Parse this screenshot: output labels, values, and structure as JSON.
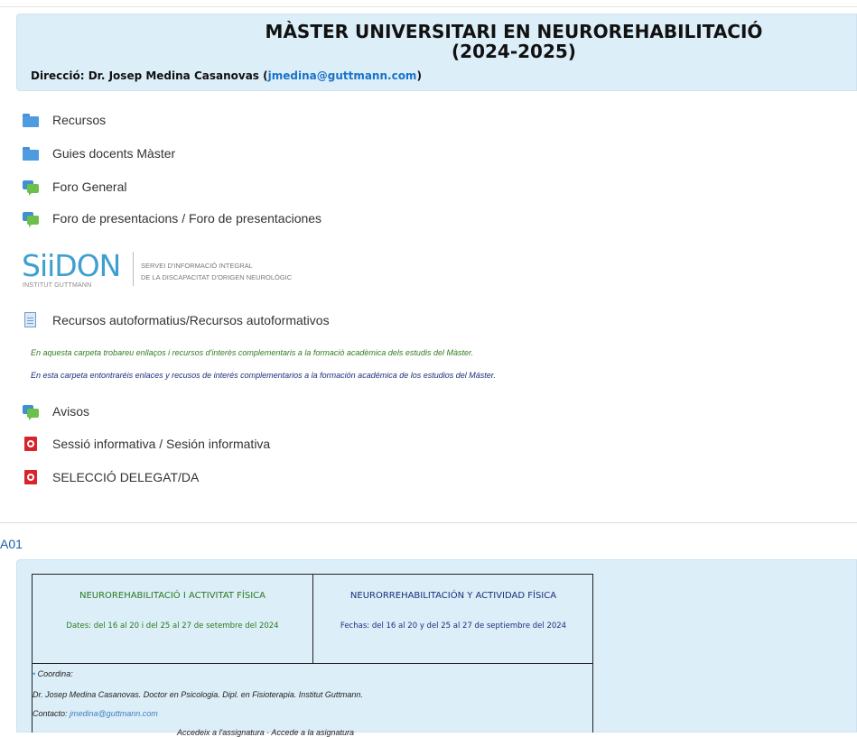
{
  "header": {
    "title_line1": "MÀSTER UNIVERSITARI EN NEUROREHABILITACIÓ",
    "title_line2": "(2024-2025)",
    "direction_prefix": "Direcció: Dr. Josep Medina Casanovas (",
    "direction_email": "jmedina@guttmann.com",
    "direction_suffix": ")"
  },
  "items": [
    {
      "label": "Recursos",
      "icon": "folder-icon"
    },
    {
      "label": "Guies docents Màster",
      "icon": "folder-icon"
    },
    {
      "label": "Foro General",
      "icon": "forum-icon"
    },
    {
      "label": "Foro de presentacions / Foro de presentaciones",
      "icon": "forum-icon"
    },
    {
      "label": "Recursos autoformatius/Recursos autoformativos",
      "icon": "page-icon"
    },
    {
      "label": "Avisos",
      "icon": "forum-icon"
    },
    {
      "label": "Sessió informativa / Sesión informativa",
      "icon": "pdf-icon"
    },
    {
      "label": "SELECCIÓ DELEGAT/DA",
      "icon": "pdf-icon"
    }
  ],
  "siidon": {
    "logo": "SiiDON",
    "sub": "INSTITUT GUTTMANN",
    "line1": "SERVEI D'INFORMACIÓ INTEGRAL",
    "line2": "DE LA DISCAPACITAT D'ORIGEN NEUROLÒGIC"
  },
  "notes": {
    "catalan": "En aquesta carpeta trobareu enllaços i recursos d'interès complementaris a la formació acadèmica dels estudis del Màster.",
    "spanish": "En esta carpeta entontraréis enlaces y recusos de interés complementarios a la formación académica de los estudios del Máster."
  },
  "section": {
    "title": "A01"
  },
  "course": {
    "title_ca": "NEUROREHABILITACIÓ I ACTIVITAT FÍSICA",
    "title_es": "NEURORREHABILITACIÓN Y ACTIVIDAD FÍSICA",
    "dates_ca": "Dates:  del 16 al 20 i del 25 al 27 de setembre  del 2024",
    "dates_es": "Fechas: del 16 al 20 y del 25 al 27 de septiembre del 2024",
    "coord_label": "Coordina:",
    "coord_name": "Dr. Josep Medina Casanovas. Doctor en Psicologia. Dipl. en Fisioterapia. Institut Guttmann.",
    "contact_label": "Contacto: ",
    "contact_email": "jmedina@guttmann.com",
    "access": "Accedeix a l'assignatura · Accede a la asignatura"
  },
  "colors": {
    "header_bg": "#dceef8",
    "link": "#1a73c9",
    "green_text": "#2a7a1e",
    "blue_text": "#1c2f7c"
  }
}
